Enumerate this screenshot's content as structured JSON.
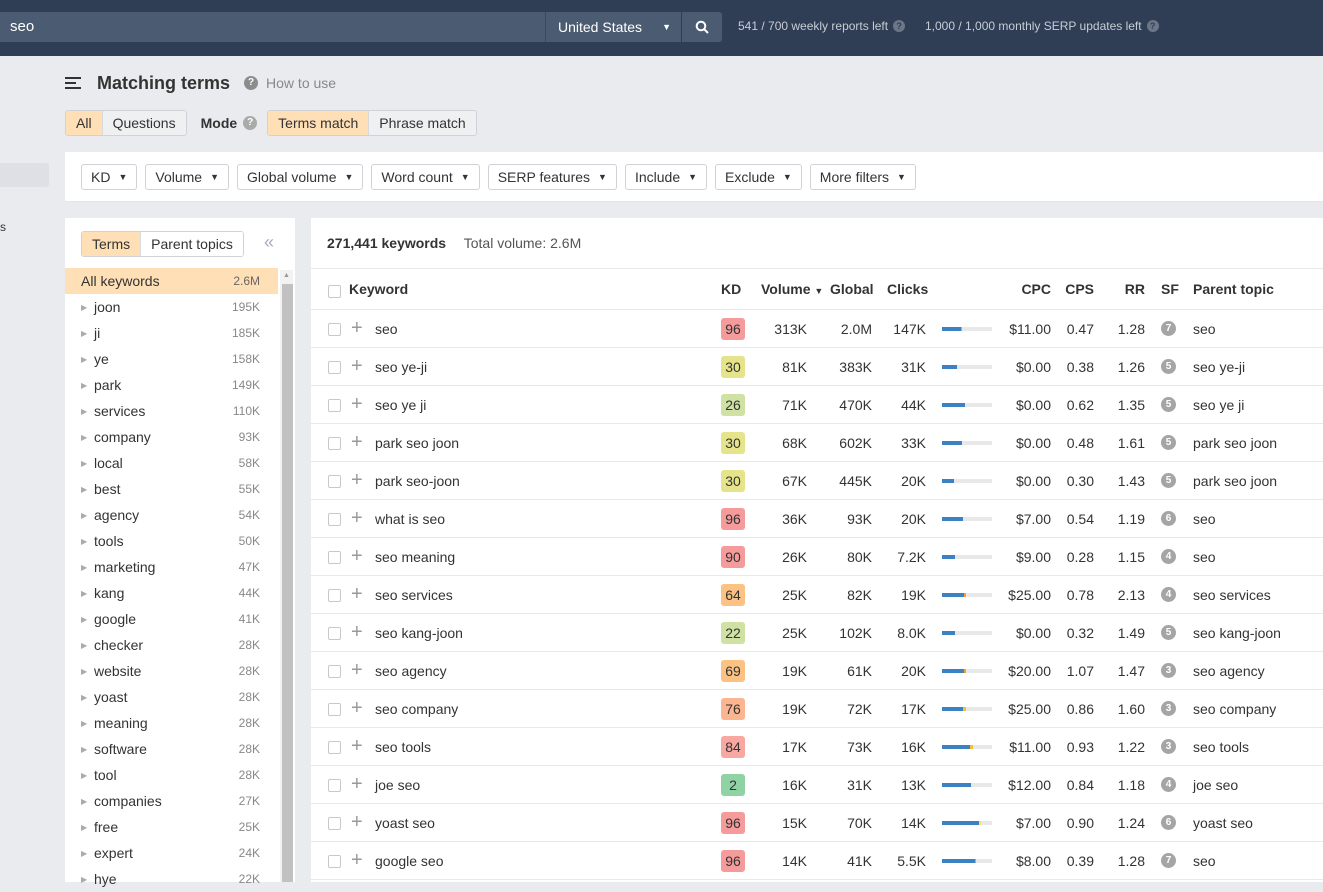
{
  "topbar": {
    "search_value": "seo",
    "country": "United States",
    "weekly_reports": "541 / 700 weekly reports left",
    "serp_updates": "1,000 / 1,000 monthly SERP updates left"
  },
  "header": {
    "title": "Matching terms",
    "how_to_use": "How to use",
    "type_tabs": [
      {
        "label": "All",
        "active": true
      },
      {
        "label": "Questions",
        "active": false
      }
    ],
    "mode_label": "Mode",
    "mode_tabs": [
      {
        "label": "Terms match",
        "active": true
      },
      {
        "label": "Phrase match",
        "active": false
      }
    ]
  },
  "filters": [
    "KD",
    "Volume",
    "Global volume",
    "Word count",
    "SERP features",
    "Include",
    "Exclude",
    "More filters"
  ],
  "side": {
    "tabs": [
      {
        "label": "Terms",
        "active": true
      },
      {
        "label": "Parent topics",
        "active": false
      }
    ],
    "items": [
      {
        "name": "All keywords",
        "count": "2.6M"
      },
      {
        "name": "joon",
        "count": "195K"
      },
      {
        "name": "ji",
        "count": "185K"
      },
      {
        "name": "ye",
        "count": "158K"
      },
      {
        "name": "park",
        "count": "149K"
      },
      {
        "name": "services",
        "count": "110K"
      },
      {
        "name": "company",
        "count": "93K"
      },
      {
        "name": "local",
        "count": "58K"
      },
      {
        "name": "best",
        "count": "55K"
      },
      {
        "name": "agency",
        "count": "54K"
      },
      {
        "name": "tools",
        "count": "50K"
      },
      {
        "name": "marketing",
        "count": "47K"
      },
      {
        "name": "kang",
        "count": "44K"
      },
      {
        "name": "google",
        "count": "41K"
      },
      {
        "name": "checker",
        "count": "28K"
      },
      {
        "name": "website",
        "count": "28K"
      },
      {
        "name": "yoast",
        "count": "28K"
      },
      {
        "name": "meaning",
        "count": "28K"
      },
      {
        "name": "software",
        "count": "28K"
      },
      {
        "name": "tool",
        "count": "28K"
      },
      {
        "name": "companies",
        "count": "27K"
      },
      {
        "name": "free",
        "count": "25K"
      },
      {
        "name": "expert",
        "count": "24K"
      },
      {
        "name": "hye",
        "count": "22K"
      }
    ]
  },
  "main": {
    "keyword_count": "271,441 keywords",
    "total_volume": "Total volume: 2.6M",
    "columns": {
      "keyword": "Keyword",
      "kd": "KD",
      "volume": "Volume",
      "global": "Global",
      "clicks": "Clicks",
      "cpc": "CPC",
      "cps": "CPS",
      "rr": "RR",
      "sf": "SF",
      "parent": "Parent topic"
    },
    "rows": [
      {
        "keyword": "seo",
        "kd": "96",
        "kd_color": "#f59b9b",
        "volume": "313K",
        "global": "2.0M",
        "clicks": "147K",
        "click_pct": 0.38,
        "paid_pct": 0.02,
        "paid_color": "#f5a030",
        "cpc": "$11.00",
        "cps": "0.47",
        "rr": "1.28",
        "sf": "7",
        "parent": "seo"
      },
      {
        "keyword": "seo ye-ji",
        "kd": "30",
        "kd_color": "#e6e48a",
        "volume": "81K",
        "global": "383K",
        "clicks": "31K",
        "click_pct": 0.3,
        "paid_pct": 0,
        "paid_color": "#f5a030",
        "cpc": "$0.00",
        "cps": "0.38",
        "rr": "1.26",
        "sf": "5",
        "parent": "seo ye-ji"
      },
      {
        "keyword": "seo ye ji",
        "kd": "26",
        "kd_color": "#cfe2a4",
        "volume": "71K",
        "global": "470K",
        "clicks": "44K",
        "click_pct": 0.46,
        "paid_pct": 0,
        "paid_color": "#f5a030",
        "cpc": "$0.00",
        "cps": "0.62",
        "rr": "1.35",
        "sf": "5",
        "parent": "seo ye ji"
      },
      {
        "keyword": "park seo joon",
        "kd": "30",
        "kd_color": "#e6e48a",
        "volume": "68K",
        "global": "602K",
        "clicks": "33K",
        "click_pct": 0.4,
        "paid_pct": 0,
        "paid_color": "#f5a030",
        "cpc": "$0.00",
        "cps": "0.48",
        "rr": "1.61",
        "sf": "5",
        "parent": "park seo joon"
      },
      {
        "keyword": "park seo-joon",
        "kd": "30",
        "kd_color": "#e6e48a",
        "volume": "67K",
        "global": "445K",
        "clicks": "20K",
        "click_pct": 0.24,
        "paid_pct": 0,
        "paid_color": "#f5a030",
        "cpc": "$0.00",
        "cps": "0.30",
        "rr": "1.43",
        "sf": "5",
        "parent": "park seo joon"
      },
      {
        "keyword": "what is seo",
        "kd": "96",
        "kd_color": "#f59b9b",
        "volume": "36K",
        "global": "93K",
        "clicks": "20K",
        "click_pct": 0.42,
        "paid_pct": 0,
        "paid_color": "#f5a030",
        "cpc": "$7.00",
        "cps": "0.54",
        "rr": "1.19",
        "sf": "6",
        "parent": "seo"
      },
      {
        "keyword": "seo meaning",
        "kd": "90",
        "kd_color": "#f59b9b",
        "volume": "26K",
        "global": "80K",
        "clicks": "7.2K",
        "click_pct": 0.26,
        "paid_pct": 0,
        "paid_color": "#f5a030",
        "cpc": "$9.00",
        "cps": "0.28",
        "rr": "1.15",
        "sf": "4",
        "parent": "seo"
      },
      {
        "keyword": "seo services",
        "kd": "64",
        "kd_color": "#fbc283",
        "volume": "25K",
        "global": "82K",
        "clicks": "19K",
        "click_pct": 0.44,
        "paid_pct": 0.04,
        "paid_color": "#f5a030",
        "cpc": "$25.00",
        "cps": "0.78",
        "rr": "2.13",
        "sf": "4",
        "parent": "seo services"
      },
      {
        "keyword": "seo kang-joon",
        "kd": "22",
        "kd_color": "#cfe2a4",
        "volume": "25K",
        "global": "102K",
        "clicks": "8.0K",
        "click_pct": 0.26,
        "paid_pct": 0,
        "paid_color": "#f5a030",
        "cpc": "$0.00",
        "cps": "0.32",
        "rr": "1.49",
        "sf": "5",
        "parent": "seo kang-joon"
      },
      {
        "keyword": "seo agency",
        "kd": "69",
        "kd_color": "#fbc283",
        "volume": "19K",
        "global": "61K",
        "clicks": "20K",
        "click_pct": 0.44,
        "paid_pct": 0.04,
        "paid_color": "#f5a030",
        "cpc": "$20.00",
        "cps": "1.07",
        "rr": "1.47",
        "sf": "3",
        "parent": "seo agency"
      },
      {
        "keyword": "seo company",
        "kd": "76",
        "kd_color": "#fbb590",
        "volume": "19K",
        "global": "72K",
        "clicks": "17K",
        "click_pct": 0.42,
        "paid_pct": 0.06,
        "paid_color": "#f5c030",
        "cpc": "$25.00",
        "cps": "0.86",
        "rr": "1.60",
        "sf": "3",
        "parent": "seo company"
      },
      {
        "keyword": "seo tools",
        "kd": "84",
        "kd_color": "#f8a8a0",
        "volume": "17K",
        "global": "73K",
        "clicks": "16K",
        "click_pct": 0.56,
        "paid_pct": 0.06,
        "paid_color": "#f5c030",
        "cpc": "$11.00",
        "cps": "0.93",
        "rr": "1.22",
        "sf": "3",
        "parent": "seo tools"
      },
      {
        "keyword": "joe seo",
        "kd": "2",
        "kd_color": "#8fd3a4",
        "volume": "16K",
        "global": "31K",
        "clicks": "13K",
        "click_pct": 0.58,
        "paid_pct": 0,
        "paid_color": "#f5a030",
        "cpc": "$12.00",
        "cps": "0.84",
        "rr": "1.18",
        "sf": "4",
        "parent": "joe seo"
      },
      {
        "keyword": "yoast seo",
        "kd": "96",
        "kd_color": "#f59b9b",
        "volume": "15K",
        "global": "70K",
        "clicks": "14K",
        "click_pct": 0.74,
        "paid_pct": 0.04,
        "paid_color": "#f5e070",
        "cpc": "$7.00",
        "cps": "0.90",
        "rr": "1.24",
        "sf": "6",
        "parent": "yoast seo"
      },
      {
        "keyword": "google seo",
        "kd": "96",
        "kd_color": "#f59b9b",
        "volume": "14K",
        "global": "41K",
        "clicks": "5.5K",
        "click_pct": 0.66,
        "paid_pct": 0.02,
        "paid_color": "#f5a030",
        "cpc": "$8.00",
        "cps": "0.39",
        "rr": "1.28",
        "sf": "7",
        "parent": "seo"
      }
    ]
  }
}
